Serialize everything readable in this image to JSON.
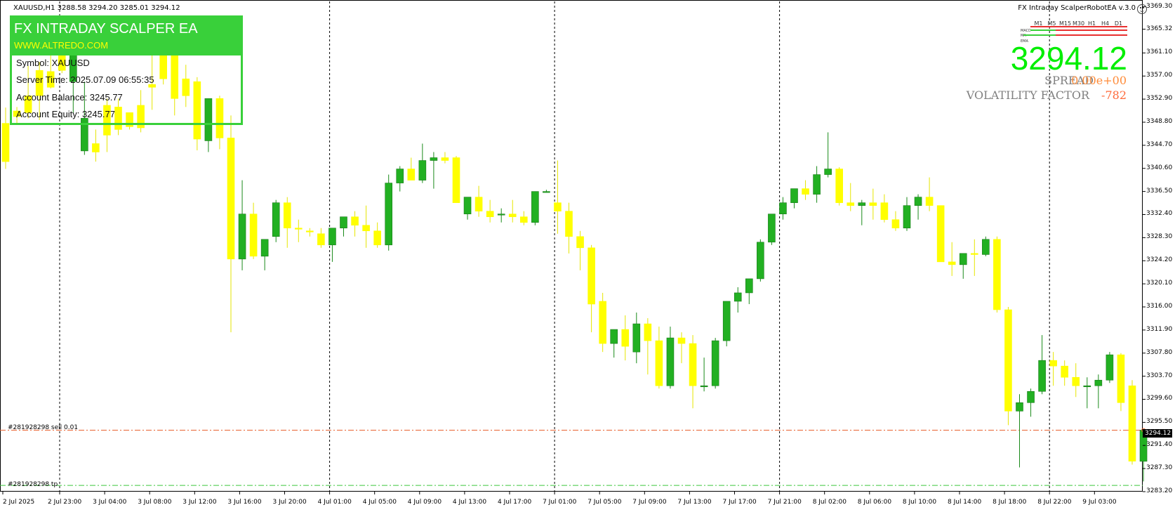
{
  "symbol_info": "XAUUSD,H1  3288.58 3294.20 3285.01 3294.12",
  "ea_title": "FX Intraday ScalperRobotEA  v.3.0",
  "panel": {
    "name": "FX INTRADAY SCALPER EA",
    "website": "WWW.ALTREDO.COM",
    "rows": [
      {
        "label": "Symbol: XAUUSD"
      },
      {
        "label": "Server Time: 2025.07.09 06:55:35"
      },
      {
        "label": "Account Balance: 3245.77"
      },
      {
        "label": "Account Equity: 3245.77"
      }
    ]
  },
  "big_price": "3294.12",
  "spread_label": "SPREAD",
  "spread_value": "0.00e+00",
  "volatility_label": "VOLATILITY FACTOR",
  "volatility_value": "-782",
  "timeframes": [
    "M1",
    "M5",
    "M15",
    "M30",
    "H1",
    "H4",
    "D1"
  ],
  "indicator_labels": [
    "MACD",
    "MA",
    "EMA"
  ],
  "orders": [
    {
      "label": "#281928298 sell 0.01",
      "price": 3294.12,
      "color": "#e8612f"
    },
    {
      "label": "#281928298 tp",
      "price": 3284.3,
      "color": "#3cc83c"
    }
  ],
  "current_price_tag": "3294.12",
  "colors": {
    "bull": "#22b022",
    "bear": "#ffff00",
    "panel": "#39d03a"
  },
  "chart_data": {
    "type": "candlestick",
    "price_range": [
      3283.2,
      3370.0
    ],
    "y_ticks": [
      "3369.30",
      "3365.32",
      "3361.10",
      "3357.00",
      "3352.90",
      "3348.80",
      "3344.70",
      "3340.60",
      "3336.50",
      "3332.40",
      "3328.30",
      "3324.20",
      "3320.10",
      "3316.00",
      "3311.90",
      "3307.80",
      "3303.70",
      "3299.60",
      "3295.50",
      "3291.40",
      "3287.30",
      "3283.20"
    ],
    "x_labels": [
      "2 Jul 2025",
      "2 Jul 23:00",
      "3 Jul 04:00",
      "3 Jul 08:00",
      "3 Jul 12:00",
      "3 Jul 16:00",
      "3 Jul 20:00",
      "4 Jul 01:00",
      "4 Jul 05:00",
      "4 Jul 09:00",
      "4 Jul 13:00",
      "4 Jul 17:00",
      "7 Jul 01:00",
      "7 Jul 05:00",
      "7 Jul 09:00",
      "7 Jul 13:00",
      "7 Jul 17:00",
      "7 Jul 21:00",
      "8 Jul 02:00",
      "8 Jul 06:00",
      "8 Jul 10:00",
      "8 Jul 14:00",
      "8 Jul 18:00",
      "8 Jul 22:00",
      "9 Jul 03:00"
    ],
    "period_separators": [
      "2 Jul 23:00",
      "4 Jul 01:00",
      "7 Jul 01:00",
      "7 Jul 21:00",
      "8 Jul 22:00"
    ],
    "candles": [
      [
        3348.6,
        3351.4,
        3340.5,
        3341.8
      ],
      [
        3350.8,
        3351.5,
        3348.5,
        3349.8
      ],
      [
        3353.5,
        3358.8,
        3349.5,
        3350.5
      ],
      [
        3358.0,
        3359.5,
        3349.2,
        3353.5
      ],
      [
        3357.8,
        3362.5,
        3354.8,
        3355.0
      ],
      [
        3362.0,
        3367.0,
        3357.5,
        3358.0
      ],
      [
        3356.0,
        3363.5,
        3350.5,
        3361.8
      ],
      [
        3343.7,
        3356.0,
        3343.0,
        3349.5
      ],
      [
        3345.0,
        3347.5,
        3341.8,
        3343.5
      ],
      [
        3351.8,
        3353.0,
        3343.5,
        3346.5
      ],
      [
        3351.5,
        3353.0,
        3346.5,
        3347.5
      ],
      [
        3350.5,
        3350.5,
        3347.5,
        3348.0
      ],
      [
        3351.8,
        3354.5,
        3347.0,
        3347.8
      ],
      [
        3355.5,
        3365.0,
        3351.0,
        3355.0
      ],
      [
        3361.0,
        3365.5,
        3355.5,
        3356.5
      ],
      [
        3362.5,
        3363.8,
        3350.0,
        3353.0
      ],
      [
        3356.5,
        3359.0,
        3351.5,
        3353.5
      ],
      [
        3356.0,
        3356.8,
        3343.8,
        3345.8
      ],
      [
        3345.5,
        3353.0,
        3343.5,
        3353.0
      ],
      [
        3353.0,
        3353.5,
        3344.0,
        3346.0
      ],
      [
        3346.0,
        3350.0,
        3311.5,
        3324.5
      ],
      [
        3324.5,
        3338.5,
        3322.5,
        3332.5
      ],
      [
        3332.5,
        3334.5,
        3324.5,
        3325.0
      ],
      [
        3325.0,
        3328.0,
        3322.5,
        3328.0
      ],
      [
        3328.5,
        3335.0,
        3327.5,
        3334.5
      ],
      [
        3334.5,
        3335.5,
        3326.5,
        3330.0
      ],
      [
        3330.0,
        3331.5,
        3327.5,
        3329.8
      ],
      [
        3329.5,
        3330.0,
        3328.5,
        3329.3
      ],
      [
        3329.0,
        3330.0,
        3326.5,
        3327.0
      ],
      [
        3327.0,
        3330.0,
        3324.0,
        3330.0
      ],
      [
        3330.0,
        3331.0,
        3328.5,
        3332.0
      ],
      [
        3332.0,
        3333.0,
        3328.5,
        3330.5
      ],
      [
        3330.5,
        3334.0,
        3326.5,
        3329.5
      ],
      [
        3329.5,
        3331.0,
        3326.5,
        3327.0
      ],
      [
        3327.0,
        3339.5,
        3326.0,
        3338.0
      ],
      [
        3338.0,
        3341.0,
        3336.5,
        3340.5
      ],
      [
        3340.5,
        3342.5,
        3338.5,
        3338.5
      ],
      [
        3338.5,
        3345.0,
        3338.0,
        3342.0
      ],
      [
        3342.0,
        3343.5,
        3337.0,
        3342.5
      ],
      [
        3342.5,
        3343.5,
        3341.5,
        3342.0
      ],
      [
        3342.5,
        3342.8,
        3334.5,
        3334.5
      ],
      [
        3332.5,
        3335.5,
        3331.5,
        3335.5
      ],
      [
        3335.5,
        3337.5,
        3332.0,
        3333.0
      ],
      [
        3333.0,
        3335.0,
        3331.0,
        3332.0
      ],
      [
        3332.5,
        3333.5,
        3331.0,
        3332.5
      ],
      [
        3332.5,
        3335.0,
        3331.0,
        3332.0
      ],
      [
        3332.0,
        3333.0,
        3330.5,
        3331.0
      ],
      [
        3331.0,
        3336.5,
        3330.5,
        3336.5
      ],
      [
        3336.5,
        3336.8,
        3336.3,
        3336.5
      ],
      [
        3334.5,
        3342.0,
        3329.0,
        3333.0
      ],
      [
        3333.0,
        3334.5,
        3325.5,
        3328.5
      ],
      [
        3328.5,
        3329.5,
        3322.5,
        3326.5
      ],
      [
        3326.5,
        3327.0,
        3311.5,
        3316.5
      ],
      [
        3317.0,
        3318.5,
        3308.0,
        3309.5
      ],
      [
        3309.5,
        3312.0,
        3307.0,
        3312.0
      ],
      [
        3312.0,
        3314.5,
        3306.5,
        3309.0
      ],
      [
        3308.0,
        3315.0,
        3306.0,
        3313.0
      ],
      [
        3313.0,
        3314.0,
        3304.0,
        3310.0
      ],
      [
        3310.0,
        3312.5,
        3301.5,
        3302.0
      ],
      [
        3302.0,
        3312.5,
        3301.5,
        3310.5
      ],
      [
        3310.5,
        3311.5,
        3306.0,
        3309.5
      ],
      [
        3309.5,
        3311.0,
        3298.0,
        3302.0
      ],
      [
        3302.0,
        3307.0,
        3301.0,
        3302.0
      ],
      [
        3302.0,
        3310.5,
        3301.5,
        3310.0
      ],
      [
        3310.0,
        3317.0,
        3309.0,
        3317.0
      ],
      [
        3317.0,
        3319.5,
        3315.0,
        3318.5
      ],
      [
        3318.5,
        3321.0,
        3316.5,
        3321.0
      ],
      [
        3321.0,
        3328.0,
        3320.5,
        3327.5
      ],
      [
        3327.5,
        3331.5,
        3327.0,
        3332.5
      ],
      [
        3332.5,
        3335.5,
        3331.5,
        3334.5
      ],
      [
        3334.5,
        3337.0,
        3333.5,
        3337.0
      ],
      [
        3337.0,
        3338.5,
        3335.0,
        3336.0
      ],
      [
        3336.0,
        3341.0,
        3334.5,
        3339.5
      ],
      [
        3339.5,
        3347.0,
        3339.0,
        3340.5
      ],
      [
        3340.5,
        3340.8,
        3334.0,
        3334.5
      ],
      [
        3334.5,
        3338.0,
        3333.0,
        3334.0
      ],
      [
        3334.0,
        3335.0,
        3330.5,
        3334.5
      ],
      [
        3334.5,
        3337.0,
        3331.5,
        3334.0
      ],
      [
        3334.5,
        3336.0,
        3331.0,
        3331.5
      ],
      [
        3331.5,
        3333.0,
        3329.5,
        3330.0
      ],
      [
        3330.0,
        3335.5,
        3329.5,
        3334.0
      ],
      [
        3334.0,
        3336.0,
        3331.5,
        3335.5
      ],
      [
        3335.5,
        3339.0,
        3333.0,
        3334.0
      ],
      [
        3334.0,
        3334.0,
        3324.0,
        3324.0
      ],
      [
        3324.0,
        3327.5,
        3321.5,
        3323.5
      ],
      [
        3323.5,
        3325.5,
        3321.0,
        3325.5
      ],
      [
        3325.5,
        3328.0,
        3321.5,
        3325.3
      ],
      [
        3325.3,
        3328.5,
        3325.0,
        3328.0
      ],
      [
        3328.0,
        3328.5,
        3315.0,
        3315.5
      ],
      [
        3315.5,
        3316.0,
        3295.0,
        3297.5
      ],
      [
        3297.5,
        3300.5,
        3287.5,
        3299.0
      ],
      [
        3299.0,
        3301.5,
        3296.5,
        3301.0
      ],
      [
        3301.0,
        3311.0,
        3300.5,
        3306.5
      ],
      [
        3306.5,
        3308.0,
        3302.0,
        3305.5
      ],
      [
        3305.5,
        3306.5,
        3302.0,
        3303.5
      ],
      [
        3303.5,
        3306.0,
        3300.0,
        3302.0
      ],
      [
        3302.0,
        3303.5,
        3298.0,
        3302.0
      ],
      [
        3302.0,
        3304.0,
        3298.0,
        3303.0
      ],
      [
        3303.0,
        3308.0,
        3302.5,
        3307.5
      ],
      [
        3307.5,
        3307.8,
        3297.5,
        3299.0
      ],
      [
        3302.0,
        3303.0,
        3288.0,
        3288.6
      ],
      [
        3288.58,
        3294.2,
        3285.01,
        3294.12
      ]
    ]
  }
}
